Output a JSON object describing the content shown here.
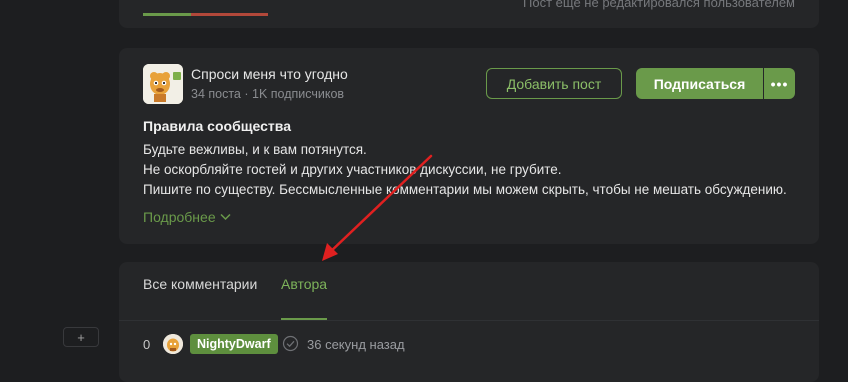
{
  "post": {
    "edit_status": "Пост еще не редактировался пользователем"
  },
  "community": {
    "name": "Спроси меня что угодно",
    "stats": "34 поста · 1K подписчиков",
    "add_post_label": "Добавить пост",
    "subscribe_label": "Подписаться",
    "more_label": "•••",
    "rules_title": "Правила сообщества",
    "rules": [
      "Будьте вежливы, и к вам потянутся.",
      "Не оскорбляйте гостей и других участников дискуссии, не грубите.",
      "Пишите по существу. Бессмысленные комментарии мы можем скрыть, чтобы не мешать обсуждению."
    ],
    "more_link": "Подробнее"
  },
  "comments": {
    "tabs": [
      "Все комментарии",
      "Автора"
    ],
    "active_tab": "Автора",
    "expand_label": "+",
    "items": [
      {
        "rating": "0",
        "username": "NightyDwarf",
        "time": "36 секунд назад"
      }
    ]
  },
  "colors": {
    "background": "#1d1e20",
    "card": "#252628",
    "accent_green": "#6a9a4a",
    "rating_minus": "#b2483a",
    "annotation_red": "#e02020"
  },
  "icons": [
    "chevron-down-icon",
    "verified-check-icon",
    "more-dots-icon",
    "plus-icon"
  ]
}
